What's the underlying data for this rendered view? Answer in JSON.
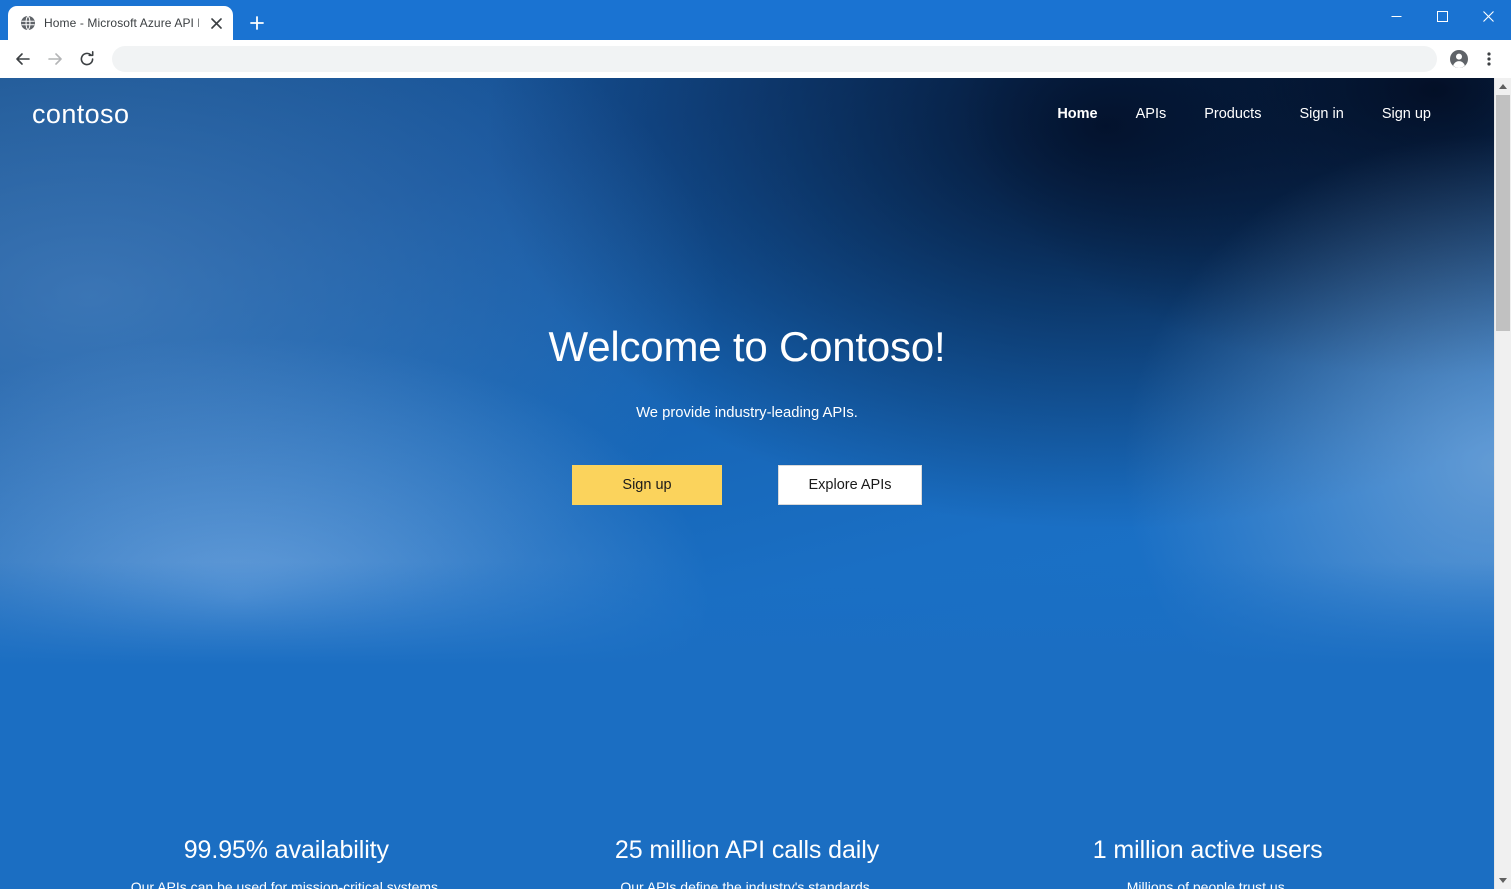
{
  "browser": {
    "tab": {
      "title": "Home - Microsoft Azure API Man",
      "favicon": "globe-icon",
      "close_label": "✕"
    },
    "new_tab_label": "+",
    "window_controls": {
      "minimize": "–",
      "maximize": "☐",
      "close": "✕"
    },
    "toolbar": {
      "back": "back-arrow-icon",
      "forward": "forward-arrow-icon",
      "reload": "reload-icon",
      "address_value": "",
      "address_placeholder": "",
      "profile": "profile-avatar-icon",
      "menu": "three-dot-menu-icon"
    },
    "scrollbar": {
      "up_arrow": "scroll-up-icon",
      "down_arrow": "scroll-down-icon"
    }
  },
  "site": {
    "logo": "contoso",
    "nav": [
      {
        "label": "Home",
        "active": true
      },
      {
        "label": "APIs",
        "active": false
      },
      {
        "label": "Products",
        "active": false
      },
      {
        "label": "Sign in",
        "active": false
      },
      {
        "label": "Sign up",
        "active": false
      }
    ],
    "hero": {
      "title": "Welcome to Contoso!",
      "subtitle": "We provide industry-leading APIs.",
      "primary_button": "Sign up",
      "secondary_button": "Explore APIs"
    },
    "stats": [
      {
        "title": "99.95% availability",
        "description": "Our APIs can be used for mission-critical systems."
      },
      {
        "title": "25 million API calls daily",
        "description": "Our APIs define the industry's standards."
      },
      {
        "title": "1 million active users",
        "description": "Millions of people trust us."
      }
    ]
  },
  "colors": {
    "browser_chrome": "#1a73d2",
    "hero_blue": "#1b6ec2",
    "hero_dark": "#020e26",
    "accent_yellow": "#fbd35c",
    "text_white": "#ffffff"
  }
}
